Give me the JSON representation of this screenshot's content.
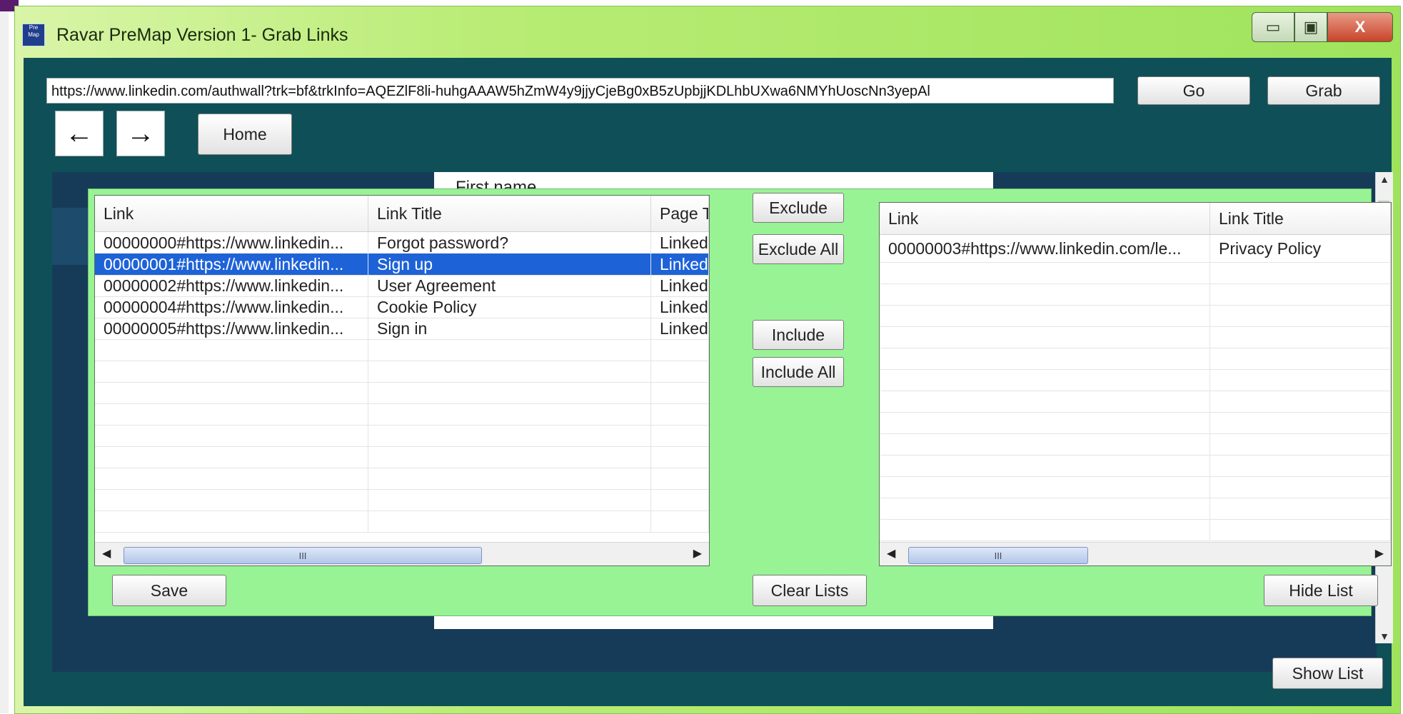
{
  "window": {
    "title": "Ravar PreMap Version 1- Grab Links",
    "icon_name": "app-icon",
    "icon_text": "Pre Map",
    "minimize_symbol": "▭",
    "maximize_symbol": "▣",
    "close_symbol": "X"
  },
  "toolbar": {
    "url": "https://www.linkedin.com/authwall?trk=bf&trkInfo=AQEZlF8li-huhgAAAW5hZmW4y9jjyCjeBg0xB5zUpbjjKDLhbUXwa6NMYhUoscNn3yepAl",
    "go_label": "Go",
    "grab_label": "Grab",
    "back_icon": "←",
    "forward_icon": "→",
    "home_label": "Home"
  },
  "background_page": {
    "form_label": "First name"
  },
  "left_grid": {
    "columns": [
      "Link",
      "Link Title",
      "Page T"
    ],
    "rows": [
      {
        "link": "00000000#https://www.linkedin...",
        "title": "Forgot password?",
        "page": "Linked"
      },
      {
        "link": "00000001#https://www.linkedin...",
        "title": "Sign up",
        "page": "Linked"
      },
      {
        "link": "00000002#https://www.linkedin...",
        "title": "User Agreement",
        "page": "Linked"
      },
      {
        "link": "00000004#https://www.linkedin...",
        "title": "Cookie Policy",
        "page": "Linked"
      },
      {
        "link": "00000005#https://www.linkedin...",
        "title": "Sign in",
        "page": "Linked"
      }
    ],
    "selected_row": 1,
    "scroll_thumb_label": "III"
  },
  "right_grid": {
    "columns": [
      "Link",
      "Link Title"
    ],
    "rows": [
      {
        "link": "00000003#https://www.linkedin.com/le...",
        "title": "Privacy Policy"
      }
    ],
    "scroll_thumb_label": "III"
  },
  "buttons": {
    "exclude": "Exclude",
    "exclude_all": "Exclude All",
    "include": "Include",
    "include_all": "Include All",
    "save": "Save",
    "clear_lists": "Clear Lists",
    "hide_list": "Hide List",
    "show_list": "Show List"
  },
  "colors": {
    "title_bar": "#b8ec74",
    "client_bg": "#0f4f57",
    "panel_bg": "#98f394",
    "selection": "#1e62d8"
  }
}
